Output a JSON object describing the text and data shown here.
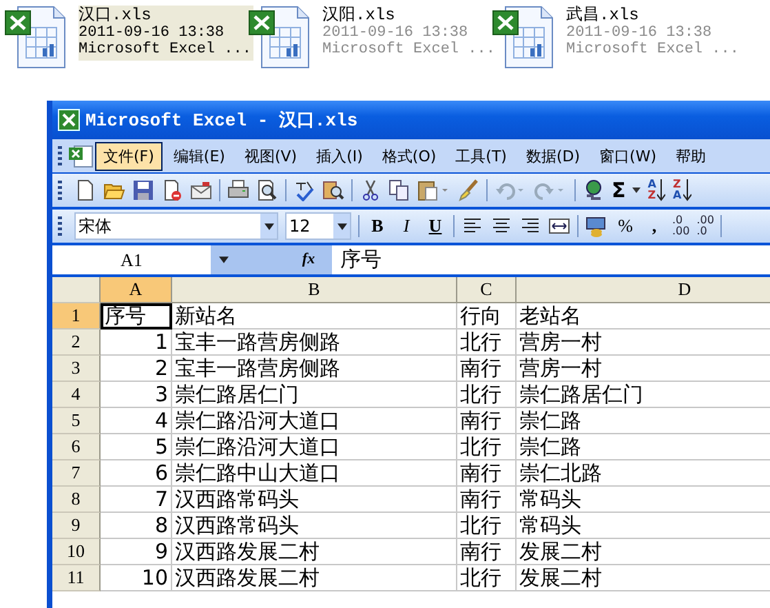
{
  "files": [
    {
      "name": "汉口.xls",
      "date": "2011-09-16 13:38",
      "type": "Microsoft Excel ...",
      "selected": true
    },
    {
      "name": "汉阳.xls",
      "date": "2011-09-16 13:38",
      "type": "Microsoft Excel ...",
      "selected": false
    },
    {
      "name": "武昌.xls",
      "date": "2011-09-16 13:38",
      "type": "Microsoft Excel ...",
      "selected": false
    }
  ],
  "window": {
    "title": "Microsoft Excel - 汉口.xls"
  },
  "menu": [
    {
      "label": "文件(F)",
      "selected": true
    },
    {
      "label": "编辑(E)",
      "selected": false
    },
    {
      "label": "视图(V)",
      "selected": false
    },
    {
      "label": "插入(I)",
      "selected": false
    },
    {
      "label": "格式(O)",
      "selected": false
    },
    {
      "label": "工具(T)",
      "selected": false
    },
    {
      "label": "数据(D)",
      "selected": false
    },
    {
      "label": "窗口(W)",
      "selected": false
    },
    {
      "label": "帮助",
      "selected": false
    }
  ],
  "standard_toolbar": {
    "autosum": "Σ",
    "sort_ascending": [
      "A",
      "Z"
    ],
    "sort_descending": [
      "Z",
      "A"
    ]
  },
  "format_toolbar": {
    "font": "宋体",
    "size": "12",
    "bold": "B",
    "italic": "I",
    "underline": "U",
    "percent": "%",
    "comma": ",",
    "increase_decimal": [
      ".0",
      ".00"
    ],
    "decrease_decimal": [
      ".00",
      ".0"
    ]
  },
  "formula_bar": {
    "name_box": "A1",
    "function_label": "fx",
    "formula": "序号"
  },
  "sheet": {
    "columns": [
      {
        "label": "A",
        "selected": true
      },
      {
        "label": "B",
        "selected": false
      },
      {
        "label": "C",
        "selected": false
      },
      {
        "label": "D",
        "selected": false
      }
    ],
    "rows": [
      {
        "number": "1",
        "selected": true,
        "cells": [
          "序号",
          "新站名",
          "行向",
          "老站名"
        ]
      },
      {
        "number": "2",
        "selected": false,
        "cells": [
          "1",
          "宝丰一路营房侧路",
          "北行",
          "营房一村"
        ]
      },
      {
        "number": "3",
        "selected": false,
        "cells": [
          "2",
          "宝丰一路营房侧路",
          "南行",
          "营房一村"
        ]
      },
      {
        "number": "4",
        "selected": false,
        "cells": [
          "3",
          "崇仁路居仁门",
          "北行",
          "崇仁路居仁门"
        ]
      },
      {
        "number": "5",
        "selected": false,
        "cells": [
          "4",
          "崇仁路沿河大道口",
          "南行",
          "崇仁路"
        ]
      },
      {
        "number": "6",
        "selected": false,
        "cells": [
          "5",
          "崇仁路沿河大道口",
          "北行",
          "崇仁路"
        ]
      },
      {
        "number": "7",
        "selected": false,
        "cells": [
          "6",
          "崇仁路中山大道口",
          "南行",
          "崇仁北路"
        ]
      },
      {
        "number": "8",
        "selected": false,
        "cells": [
          "7",
          "汉西路常码头",
          "南行",
          "常码头"
        ]
      },
      {
        "number": "9",
        "selected": false,
        "cells": [
          "8",
          "汉西路常码头",
          "北行",
          "常码头"
        ]
      },
      {
        "number": "10",
        "selected": false,
        "cells": [
          "9",
          "汉西路发展二村",
          "南行",
          "发展二村"
        ]
      },
      {
        "number": "11",
        "selected": false,
        "cells": [
          "10",
          "汉西路发展二村",
          "北行",
          "发展二村"
        ]
      }
    ]
  }
}
